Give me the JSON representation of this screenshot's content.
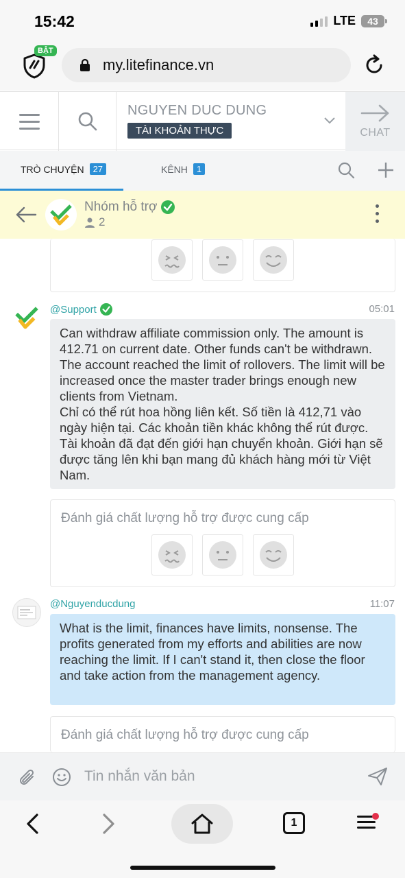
{
  "status_bar": {
    "time": "15:42",
    "network": "LTE",
    "battery": "43"
  },
  "browser": {
    "shield_badge": "BẬT",
    "url": "my.litefinance.vn"
  },
  "header": {
    "account_name": "NGUYEN DUC DUNG",
    "account_type": "TÀI KHOẢN THỰC",
    "chat_label": "CHAT"
  },
  "tabs": [
    {
      "label": "TRÒ CHUYỆN",
      "count": "27"
    },
    {
      "label": "KÊNH",
      "count": "1"
    }
  ],
  "conversation": {
    "title": "Nhóm hỗ trợ",
    "members": "2"
  },
  "messages": [
    {
      "sender": "@Support",
      "time": "05:01",
      "lines": [
        "Can withdraw affiliate commission only. The amount is 412.71 on current date. Other funds can't be withdrawn. The account reached the limit of rollovers. The limit will be increased once the master trader brings enough new clients from Vietnam.",
        "Chỉ có thể rút hoa hồng liên kết. Số tiền là 412,71 vào ngày hiện tại. Các khoản tiền khác không thể rút được. Tài khoản đã đạt đến giới hạn chuyển khoản. Giới hạn sẽ được tăng lên khi bạn mang đủ khách hàng mới từ Việt Nam."
      ]
    },
    {
      "sender": "@Nguyenducdung",
      "time": "11:07",
      "lines": [
        "What is the limit, finances have limits, nonsense. The profits generated from my efforts and abilities are now reaching the limit. If I can't stand it, then close the floor and take action from the management agency."
      ]
    }
  ],
  "rating_prompt": "Đánh giá chất lượng hỗ trợ được cung cấp",
  "composer": {
    "placeholder": "Tin nhắn văn bản"
  },
  "bottom_nav": {
    "tab_count": "1"
  },
  "colors": {
    "accent": "#2b8fd6",
    "support_bubble": "#eceef0",
    "user_bubble": "#cfe8fa",
    "conversation_header": "#fdfbd6",
    "verified": "#35b553"
  },
  "icons": [
    "shield-icon",
    "lock-icon",
    "reload-icon",
    "menu-icon",
    "search-icon",
    "chevron-down-icon",
    "arrow-right-icon",
    "plus-icon",
    "back-arrow-icon",
    "verified-icon",
    "person-icon",
    "kebab-icon",
    "sad-face-icon",
    "neutral-face-icon",
    "happy-face-icon",
    "paperclip-icon",
    "smile-icon",
    "send-icon",
    "home-icon"
  ]
}
